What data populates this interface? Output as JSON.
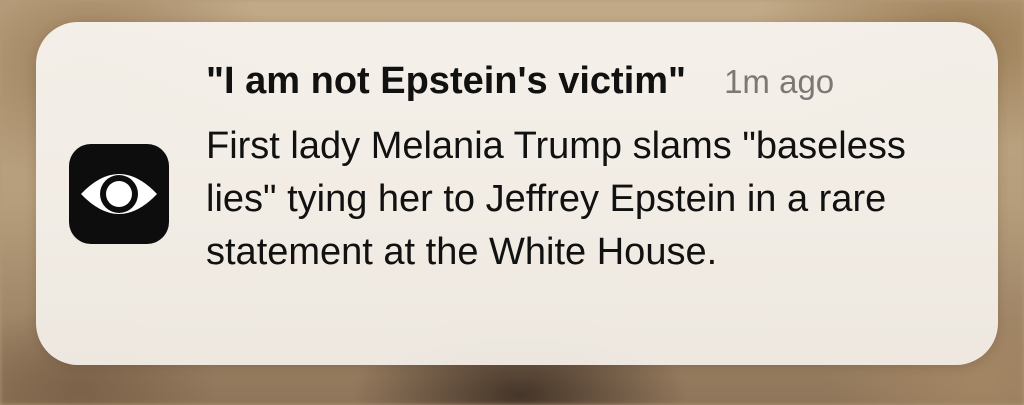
{
  "notification": {
    "app_icon": "cbs-eye-icon",
    "title": "\"I am not Epstein's victim\"",
    "time": "1m ago",
    "body": "First lady Melania Trump slams \"baseless lies\" tying her to Jeffrey Epstein in a rare statement at the White House."
  },
  "colors": {
    "card_background": "#f4f0ea",
    "title_text": "#111111",
    "time_text": "#7d7874",
    "icon_background": "#0d0d0d"
  }
}
